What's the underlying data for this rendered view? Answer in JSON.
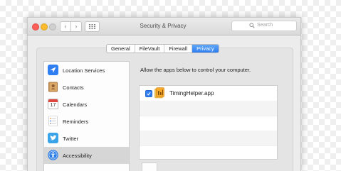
{
  "window": {
    "title": "Security & Privacy",
    "search_placeholder": "Search"
  },
  "nav": {
    "back_glyph": "‹",
    "forward_glyph": "›"
  },
  "tabs": [
    {
      "label": "General",
      "active": false
    },
    {
      "label": "FileVault",
      "active": false
    },
    {
      "label": "Firewall",
      "active": false
    },
    {
      "label": "Privacy",
      "active": true
    }
  ],
  "sidebar": {
    "items": [
      {
        "label": "Location Services",
        "icon": "location-arrow-icon",
        "selected": false
      },
      {
        "label": "Contacts",
        "icon": "contacts-book-icon",
        "selected": false
      },
      {
        "label": "Calendars",
        "icon": "calendar-icon",
        "selected": false
      },
      {
        "label": "Reminders",
        "icon": "reminders-list-icon",
        "selected": false
      },
      {
        "label": "Twitter",
        "icon": "twitter-bird-icon",
        "selected": false
      },
      {
        "label": "Accessibility",
        "icon": "accessibility-icon",
        "selected": true
      }
    ],
    "calendar_day": "17"
  },
  "main": {
    "description": "Allow the apps below to control your computer.",
    "apps": [
      {
        "name": "TimingHelper.app",
        "checked": true,
        "icon": "timing-app-icon"
      }
    ]
  },
  "colors": {
    "accent": "#2f7ef2",
    "close": "#fc5f57",
    "minimize": "#fdbc2e"
  }
}
